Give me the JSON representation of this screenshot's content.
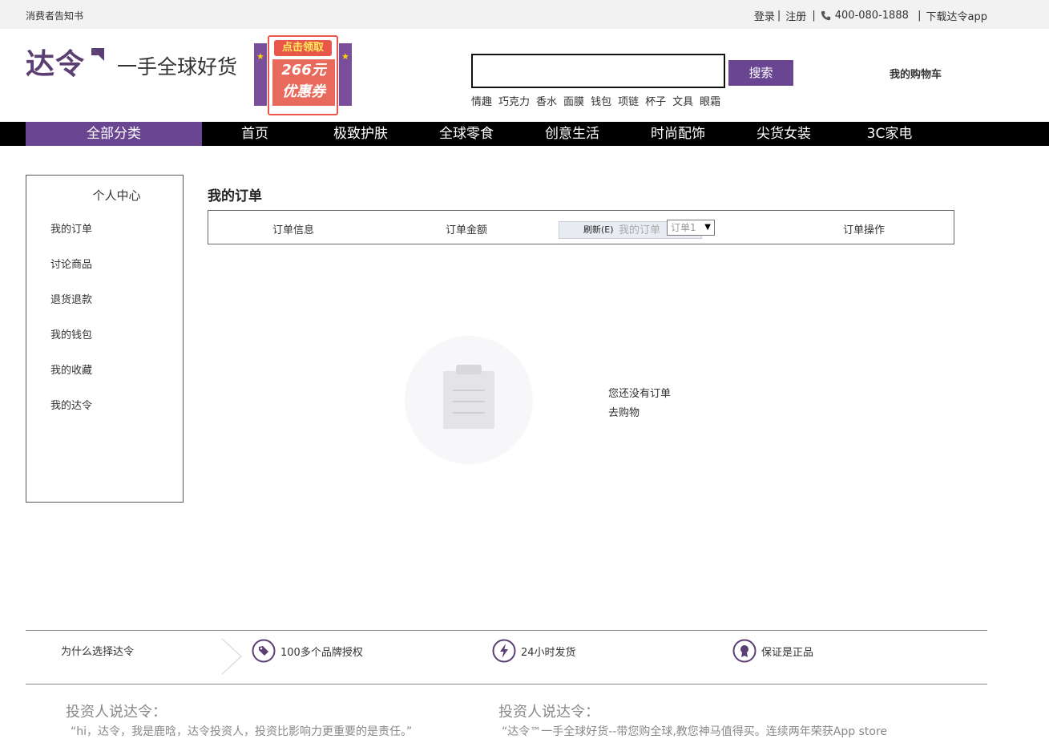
{
  "topbar": {
    "notice": "消费者告知书",
    "login": "登录",
    "register": "注册",
    "phone": "400-080-1888",
    "download": "下载达令app"
  },
  "header": {
    "logo": "达令",
    "slogan": "一手全球好货",
    "coupon": {
      "head": "点击领取",
      "amount": "266元",
      "label": "优惠券"
    },
    "search": {
      "placeholder": "",
      "button": "搜索"
    },
    "hotwords": [
      "情趣",
      "巧克力",
      "香水",
      "面膜",
      "钱包",
      "项链",
      "杯子",
      "文具",
      "眼霜"
    ],
    "cart": "我的购物车"
  },
  "nav": {
    "all": "全部分类",
    "items": [
      "首页",
      "极致护肤",
      "全球零食",
      "创意生活",
      "时尚配饰",
      "尖货女装",
      "3C家电"
    ]
  },
  "sidebar": {
    "title": "个人中心",
    "items": [
      "我的订单",
      "讨论商品",
      "退货退款",
      "我的钱包",
      "我的收藏",
      "我的达令"
    ]
  },
  "main": {
    "title": "我的订单",
    "columns": [
      "订单信息",
      "订单金额",
      "订单操作"
    ],
    "refresh": "刷新(E)",
    "myorder_label": "我的订单",
    "select_value": "订单1",
    "empty_text": "您还没有订单",
    "empty_link": "去购物"
  },
  "features": {
    "why": "为什么选择达令",
    "items": [
      "100多个品牌授权",
      "24小时发货",
      "保证是正品"
    ]
  },
  "investors": [
    {
      "title": "投资人说达令：",
      "quote": "“hi，达令，我是鹿晗，达令投资人，投资比影响力更重要的是责任。”"
    },
    {
      "title": "投资人说达令：",
      "quote": "“达令™一手全球好货--带您购全球,教您神马值得买。连续两年荣获App store"
    }
  ],
  "colors": {
    "brand": "#6a4591",
    "nav_bg": "#000000",
    "coupon_red": "#e8574a"
  }
}
